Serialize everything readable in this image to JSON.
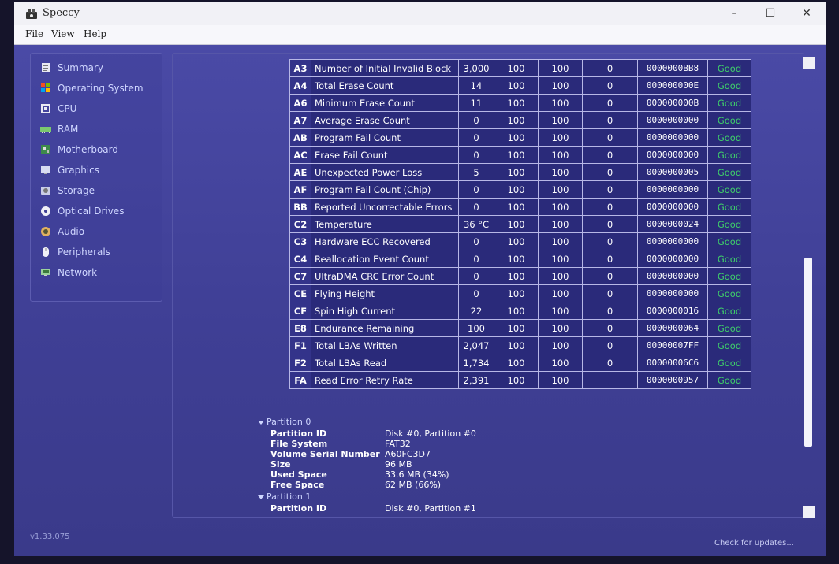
{
  "window": {
    "title": "Speccy",
    "minimize": "–",
    "maximize": "☐",
    "close": "✕"
  },
  "menu": {
    "file": "File",
    "view": "View",
    "help": "Help"
  },
  "sidebar": {
    "items": [
      {
        "label": "Summary",
        "icon": "summary-icon"
      },
      {
        "label": "Operating System",
        "icon": "windows-icon"
      },
      {
        "label": "CPU",
        "icon": "cpu-icon"
      },
      {
        "label": "RAM",
        "icon": "ram-icon"
      },
      {
        "label": "Motherboard",
        "icon": "motherboard-icon"
      },
      {
        "label": "Graphics",
        "icon": "graphics-icon"
      },
      {
        "label": "Storage",
        "icon": "storage-icon"
      },
      {
        "label": "Optical Drives",
        "icon": "optical-drive-icon"
      },
      {
        "label": "Audio",
        "icon": "audio-icon"
      },
      {
        "label": "Peripherals",
        "icon": "peripherals-icon"
      },
      {
        "label": "Network",
        "icon": "network-icon"
      }
    ]
  },
  "version": "v1.33.075",
  "check_updates": "Check for updates...",
  "smart": {
    "rows": [
      {
        "id": "A3",
        "name": "Number of Initial Invalid Block",
        "raw": "3,000",
        "current": "100",
        "worst": "100",
        "threshold": "0",
        "data": "0000000BB8",
        "status": "Good"
      },
      {
        "id": "A4",
        "name": "Total Erase Count",
        "raw": "14",
        "current": "100",
        "worst": "100",
        "threshold": "0",
        "data": "000000000E",
        "status": "Good"
      },
      {
        "id": "A6",
        "name": "Minimum Erase Count",
        "raw": "11",
        "current": "100",
        "worst": "100",
        "threshold": "0",
        "data": "000000000B",
        "status": "Good"
      },
      {
        "id": "A7",
        "name": "Average Erase Count",
        "raw": "0",
        "current": "100",
        "worst": "100",
        "threshold": "0",
        "data": "0000000000",
        "status": "Good"
      },
      {
        "id": "AB",
        "name": "Program Fail Count",
        "raw": "0",
        "current": "100",
        "worst": "100",
        "threshold": "0",
        "data": "0000000000",
        "status": "Good"
      },
      {
        "id": "AC",
        "name": "Erase Fail Count",
        "raw": "0",
        "current": "100",
        "worst": "100",
        "threshold": "0",
        "data": "0000000000",
        "status": "Good"
      },
      {
        "id": "AE",
        "name": "Unexpected Power Loss",
        "raw": "5",
        "current": "100",
        "worst": "100",
        "threshold": "0",
        "data": "0000000005",
        "status": "Good"
      },
      {
        "id": "AF",
        "name": "Program Fail Count (Chip)",
        "raw": "0",
        "current": "100",
        "worst": "100",
        "threshold": "0",
        "data": "0000000000",
        "status": "Good"
      },
      {
        "id": "BB",
        "name": "Reported Uncorrectable Errors",
        "raw": "0",
        "current": "100",
        "worst": "100",
        "threshold": "0",
        "data": "0000000000",
        "status": "Good"
      },
      {
        "id": "C2",
        "name": "Temperature",
        "raw": "36 °C",
        "current": "100",
        "worst": "100",
        "threshold": "0",
        "data": "0000000024",
        "status": "Good"
      },
      {
        "id": "C3",
        "name": "Hardware ECC Recovered",
        "raw": "0",
        "current": "100",
        "worst": "100",
        "threshold": "0",
        "data": "0000000000",
        "status": "Good"
      },
      {
        "id": "C4",
        "name": "Reallocation Event Count",
        "raw": "0",
        "current": "100",
        "worst": "100",
        "threshold": "0",
        "data": "0000000000",
        "status": "Good"
      },
      {
        "id": "C7",
        "name": "UltraDMA CRC Error Count",
        "raw": "0",
        "current": "100",
        "worst": "100",
        "threshold": "0",
        "data": "0000000000",
        "status": "Good"
      },
      {
        "id": "CE",
        "name": "Flying Height",
        "raw": "0",
        "current": "100",
        "worst": "100",
        "threshold": "0",
        "data": "0000000000",
        "status": "Good"
      },
      {
        "id": "CF",
        "name": "Spin High Current",
        "raw": "22",
        "current": "100",
        "worst": "100",
        "threshold": "0",
        "data": "0000000016",
        "status": "Good"
      },
      {
        "id": "E8",
        "name": "Endurance Remaining",
        "raw": "100",
        "current": "100",
        "worst": "100",
        "threshold": "0",
        "data": "0000000064",
        "status": "Good"
      },
      {
        "id": "F1",
        "name": "Total LBAs Written",
        "raw": "2,047",
        "current": "100",
        "worst": "100",
        "threshold": "0",
        "data": "00000007FF",
        "status": "Good"
      },
      {
        "id": "F2",
        "name": "Total LBAs Read",
        "raw": "1,734",
        "current": "100",
        "worst": "100",
        "threshold": "0",
        "data": "00000006C6",
        "status": "Good"
      },
      {
        "id": "FA",
        "name": "Read Error Retry Rate",
        "raw": "2,391",
        "current": "100",
        "worst": "100",
        "threshold": "",
        "data": "0000000957",
        "status": "Good"
      }
    ]
  },
  "partitions": {
    "p0": {
      "title": "Partition 0",
      "rows": [
        {
          "label": "Partition ID",
          "value": "Disk #0, Partition #0"
        },
        {
          "label": "File System",
          "value": "FAT32"
        },
        {
          "label": "Volume Serial Number",
          "value": "A60FC3D7"
        },
        {
          "label": "Size",
          "value": "96 MB"
        },
        {
          "label": "Used Space",
          "value": "33.6 MB (34%)"
        },
        {
          "label": "Free Space",
          "value": "62 MB (66%)"
        }
      ]
    },
    "p1": {
      "title": "Partition 1",
      "rows": [
        {
          "label": "Partition ID",
          "value": "Disk #0, Partition #1"
        }
      ]
    }
  }
}
